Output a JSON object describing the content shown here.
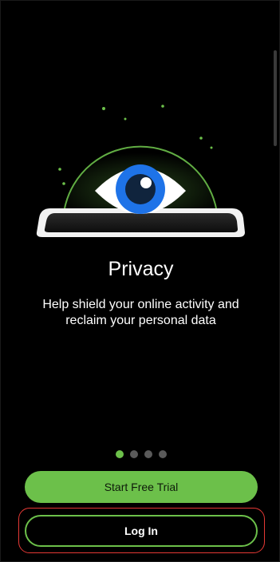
{
  "onboarding": {
    "title": "Privacy",
    "description": "Help shield your online activity and reclaim your personal data",
    "illustration": "eye-over-phone-illustration",
    "pager": {
      "total": 4,
      "active_index": 0
    }
  },
  "buttons": {
    "start_trial_label": "Start Free Trial",
    "login_label": "Log In"
  },
  "colors": {
    "accent_green": "#6cc04a",
    "eye_blue": "#1e73e8",
    "background": "#000000",
    "highlight_red": "#e53935"
  }
}
